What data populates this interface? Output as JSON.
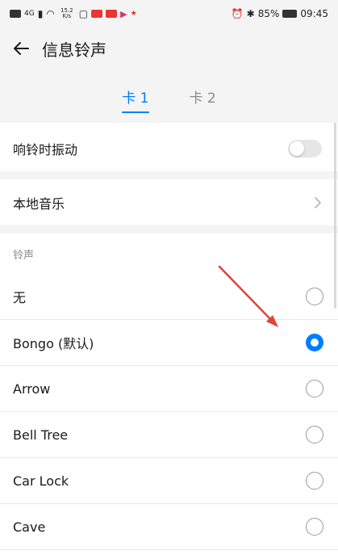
{
  "status_bar": {
    "network": "4G",
    "speed": "15.2 K/s",
    "battery": "85%",
    "time": "09:45"
  },
  "app_bar": {
    "title": "信息铃声"
  },
  "tabs": [
    {
      "label": "卡 1",
      "active": true
    },
    {
      "label": "卡 2",
      "active": false
    }
  ],
  "settings": {
    "vibrate_label": "响铃时振动",
    "vibrate_on": false,
    "local_music_label": "本地音乐"
  },
  "ringtones": {
    "section_title": "铃声",
    "items": [
      {
        "label": "无",
        "selected": false
      },
      {
        "label": "Bongo (默认)",
        "selected": true
      },
      {
        "label": "Arrow",
        "selected": false
      },
      {
        "label": "Bell Tree",
        "selected": false
      },
      {
        "label": "Car Lock",
        "selected": false
      },
      {
        "label": "Cave",
        "selected": false
      }
    ]
  },
  "colors": {
    "accent": "#007dff",
    "background": "#f4f4f4",
    "annotation_arrow": "#e0443a"
  }
}
